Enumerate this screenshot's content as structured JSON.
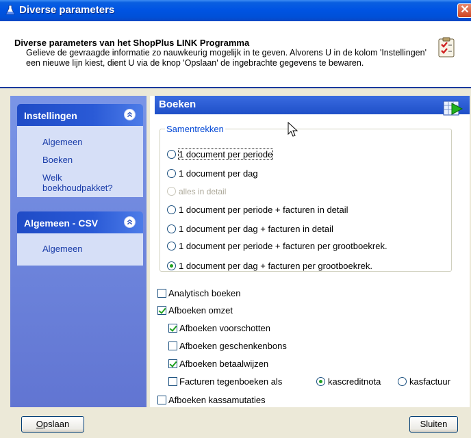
{
  "window": {
    "title": "Diverse parameters",
    "close_glyph": "✕"
  },
  "header": {
    "title": "Diverse parameters van het ShopPlus LINK Programma",
    "description": "Gelieve de gevraagde informatie zo nauwkeurig mogelijk in te geven. Alvorens U in de kolom 'Instellingen' een nieuwe lijn kiest, dient U via de knop 'Opslaan' de ingebrachte gegevens te bewaren."
  },
  "nav": {
    "groups": [
      {
        "title": "Instellingen",
        "items": [
          "Algemeen",
          "Boeken",
          "Welk boekhoudpakket?"
        ]
      },
      {
        "title": "Algemeen - CSV",
        "items": [
          "Algemeen"
        ]
      }
    ]
  },
  "section": {
    "title": "Boeken",
    "group_label": "Samentrekken",
    "radios": [
      {
        "label": "1 document per periode",
        "selected": false,
        "disabled": false,
        "focused": true
      },
      {
        "label": "1 document per dag",
        "selected": false,
        "disabled": false,
        "focused": false
      },
      {
        "label": "alles in detail",
        "selected": false,
        "disabled": true,
        "focused": false
      },
      {
        "label": "1 document per periode + facturen in detail",
        "selected": false,
        "disabled": false,
        "focused": false
      },
      {
        "label": "1 document per dag + facturen in detail",
        "selected": false,
        "disabled": false,
        "focused": false
      },
      {
        "label": "1 document per periode + facturen per grootboekrek.",
        "selected": false,
        "disabled": false,
        "focused": false
      },
      {
        "label": "1 document per dag + facturen per grootboekrek.",
        "selected": true,
        "disabled": false,
        "focused": false
      }
    ],
    "checkboxes": [
      {
        "label": "Analytisch boeken",
        "checked": false
      },
      {
        "label": "Afboeken omzet",
        "checked": true
      },
      {
        "label": "Afboeken voorschotten",
        "checked": true
      },
      {
        "label": "Afboeken geschenkenbons",
        "checked": false
      },
      {
        "label": "Afboeken betaalwijzen",
        "checked": true
      },
      {
        "label": "Facturen tegenboeken als",
        "checked": false
      },
      {
        "label": "Afboeken kassamutaties",
        "checked": false
      }
    ],
    "invoice_options": [
      {
        "label": "kascreditnota",
        "selected": true
      },
      {
        "label": "kasfactuur",
        "selected": false
      }
    ]
  },
  "buttons": {
    "save": "Opslaan",
    "save_mnemonic": "O",
    "save_rest": "pslaan",
    "close": "Sluiten"
  },
  "colors": {
    "titlebar": "#0054e3",
    "nav_background": "#6f86db",
    "group_header": "#1f4bc6",
    "link": "#1a3ca8",
    "legend": "#0046d5"
  }
}
